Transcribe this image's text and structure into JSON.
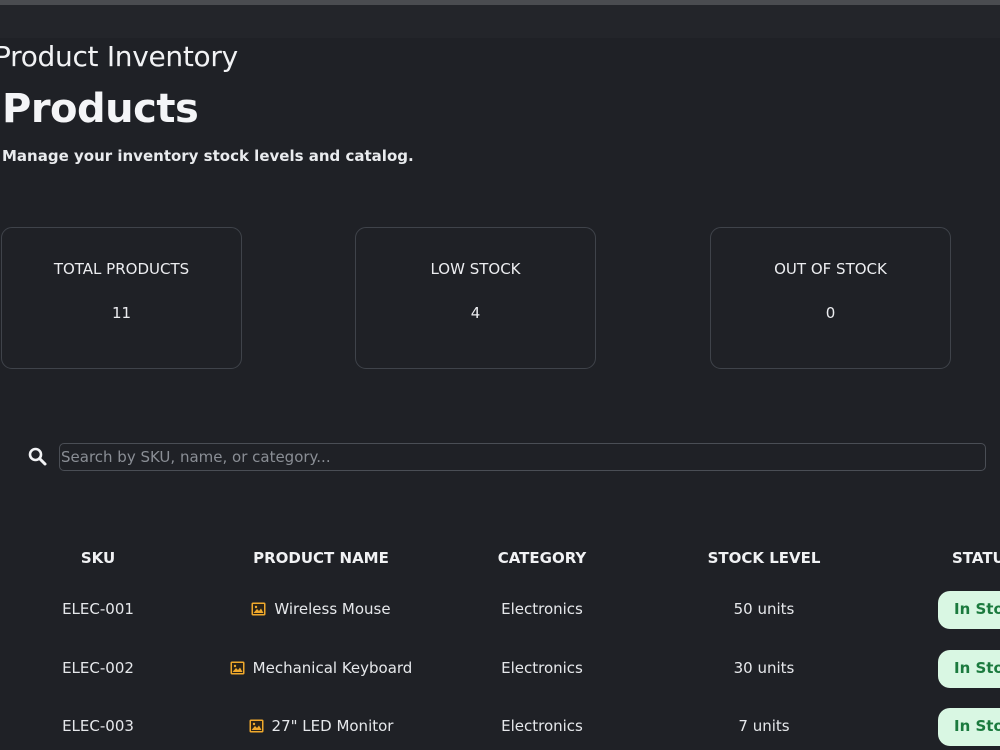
{
  "header": {
    "app_title": "Product Inventory",
    "page_title": "Products",
    "subtitle": "Manage your inventory stock levels and catalog."
  },
  "stats": {
    "total": {
      "label": "TOTAL PRODUCTS",
      "value": "11"
    },
    "low": {
      "label": "LOW STOCK",
      "value": "4"
    },
    "out": {
      "label": "OUT OF STOCK",
      "value": "0"
    }
  },
  "search": {
    "placeholder": "Search by SKU, name, or category...",
    "value": ""
  },
  "table": {
    "headers": [
      "SKU",
      "PRODUCT NAME",
      "CATEGORY",
      "STOCK LEVEL",
      "STATUS"
    ],
    "rows": [
      {
        "sku": "ELEC-001",
        "name": "Wireless Mouse",
        "category": "Electronics",
        "stock": "50 units",
        "status": "In Stock"
      },
      {
        "sku": "ELEC-002",
        "name": "Mechanical Keyboard",
        "category": "Electronics",
        "stock": "30 units",
        "status": "In Stock"
      },
      {
        "sku": "ELEC-003",
        "name": "27\" LED Monitor",
        "category": "Electronics",
        "stock": "7 units",
        "status": "In Stock"
      }
    ]
  },
  "icons": {
    "search": "search-icon",
    "product_image": "image-icon"
  },
  "colors": {
    "background": "#1f2126",
    "status_badge_bg": "#d9f7e3",
    "status_badge_text": "#1b7a3e",
    "image_icon": "#f0a92c"
  }
}
